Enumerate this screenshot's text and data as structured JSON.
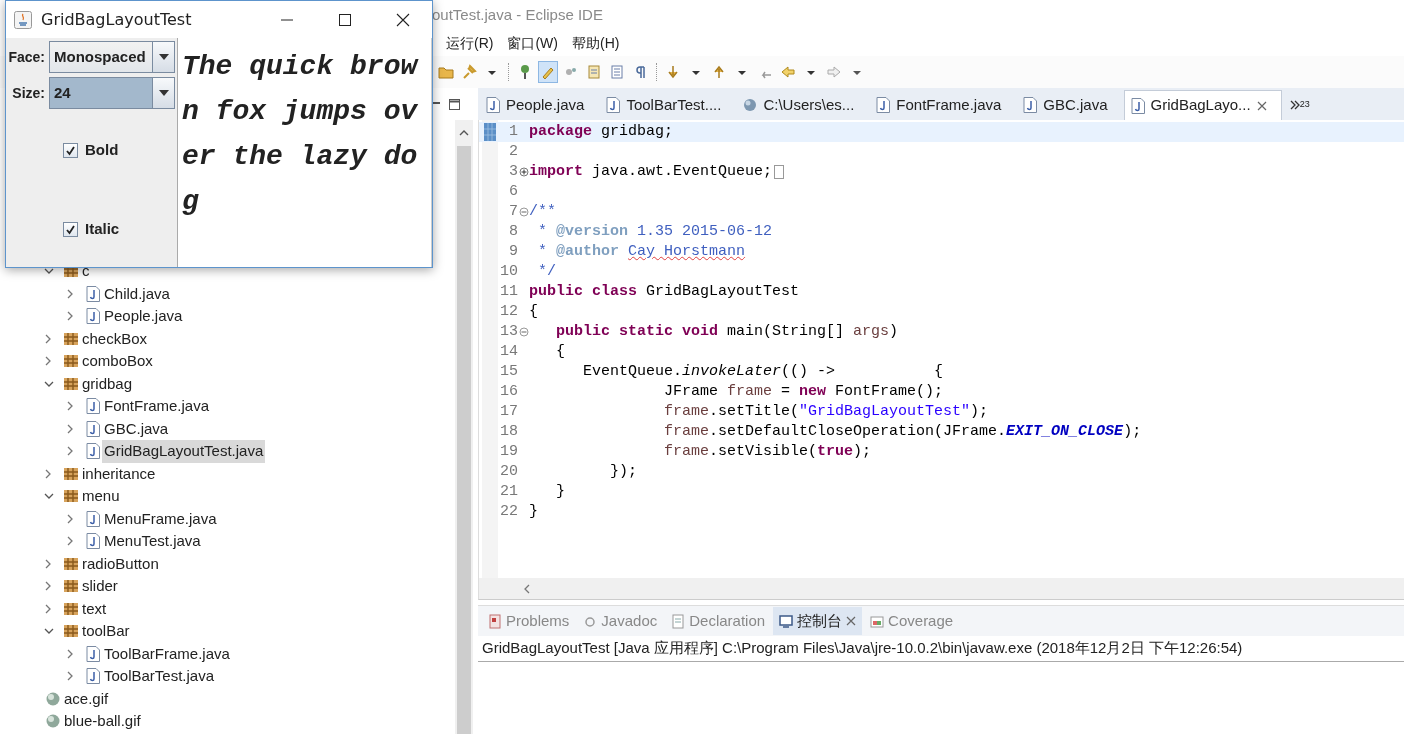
{
  "ide_window": {
    "title": "outTest.java - Eclipse IDE"
  },
  "menu": [
    "运行(R)",
    "窗口(W)",
    "帮助(H)"
  ],
  "toolbar": {
    "highlight_toggle_on": true
  },
  "package_explorer": {
    "packages": [
      {
        "label": "c",
        "expanded": true,
        "selected": false,
        "children": [
          {
            "label": "Child.java",
            "expanded": false,
            "selected": false
          },
          {
            "label": "People.java",
            "expanded": false,
            "selected": false
          }
        ]
      },
      {
        "label": "checkBox",
        "expanded": false,
        "selected": false
      },
      {
        "label": "comboBox",
        "expanded": false,
        "selected": false
      },
      {
        "label": "gridbag",
        "expanded": true,
        "selected": false,
        "children": [
          {
            "label": "FontFrame.java",
            "expanded": false,
            "selected": false
          },
          {
            "label": "GBC.java",
            "expanded": false,
            "selected": false
          },
          {
            "label": "GridBagLayoutTest.java",
            "expanded": false,
            "selected": true
          }
        ]
      },
      {
        "label": "inheritance",
        "expanded": false,
        "selected": false
      },
      {
        "label": "menu",
        "expanded": true,
        "selected": false,
        "children": [
          {
            "label": "MenuFrame.java",
            "expanded": false,
            "selected": false
          },
          {
            "label": "MenuTest.java",
            "expanded": false,
            "selected": false
          }
        ]
      },
      {
        "label": "radioButton",
        "expanded": false,
        "selected": false
      },
      {
        "label": "slider",
        "expanded": false,
        "selected": false
      },
      {
        "label": "text",
        "expanded": false,
        "selected": false
      },
      {
        "label": "toolBar",
        "expanded": true,
        "selected": false,
        "children": [
          {
            "label": "ToolBarFrame.java",
            "expanded": false,
            "selected": false
          },
          {
            "label": "ToolBarTest.java",
            "expanded": false,
            "selected": false
          }
        ]
      }
    ],
    "resources": [
      {
        "label": "ace.gif",
        "selected": false
      },
      {
        "label": "blue-ball.gif",
        "selected": false
      }
    ]
  },
  "editor_tabs": [
    {
      "label": "People.java",
      "kind": "java",
      "selected": false
    },
    {
      "label": "ToolBarTest....",
      "kind": "java",
      "selected": false
    },
    {
      "label": "C:\\Users\\es...",
      "kind": "web",
      "selected": false
    },
    {
      "label": "FontFrame.java",
      "kind": "java",
      "selected": false
    },
    {
      "label": "GBC.java",
      "kind": "java",
      "selected": false
    },
    {
      "label": "GridBagLayo...",
      "kind": "java",
      "selected": true
    }
  ],
  "tab_overflow_count": "23",
  "code_lines": [
    {
      "number": "1",
      "current": true,
      "tokens": [
        {
          "kind": "kw",
          "text": "package"
        },
        {
          "kind": "text",
          "text": " gridbag;"
        }
      ]
    },
    {
      "number": "2",
      "current": false
    },
    {
      "number": "3",
      "current": false,
      "folded": true,
      "tokens": [
        {
          "kind": "kw",
          "text": "import"
        },
        {
          "kind": "text",
          "text": " java.awt.EventQueue;"
        }
      ]
    },
    {
      "number": "6",
      "current": false
    },
    {
      "number": "7",
      "current": false,
      "folded": false,
      "tokens": [
        {
          "kind": "comment",
          "text": "/**"
        }
      ]
    },
    {
      "number": "8",
      "current": false,
      "tokens": [
        {
          "kind": "comment",
          "text": " * "
        },
        {
          "kind": "doctag",
          "text": "@version"
        },
        {
          "kind": "comment",
          "text": " 1.35 2015-06-12"
        }
      ]
    },
    {
      "number": "9",
      "current": false,
      "tokens": [
        {
          "kind": "comment",
          "text": " * "
        },
        {
          "kind": "doctag",
          "text": "@author "
        },
        {
          "kind": "misspelled",
          "text": "Cay Horstmann"
        }
      ]
    },
    {
      "number": "10",
      "current": false,
      "tokens": [
        {
          "kind": "comment",
          "text": " */"
        }
      ]
    },
    {
      "number": "11",
      "current": false,
      "tokens": [
        {
          "kind": "kw",
          "text": "public class"
        },
        {
          "kind": "text",
          "text": " GridBagLayoutTest"
        }
      ]
    },
    {
      "number": "12",
      "current": false,
      "tokens": [
        {
          "kind": "text",
          "text": "{"
        }
      ]
    },
    {
      "number": "13",
      "current": false,
      "folded": false,
      "tokens": [
        {
          "kind": "kw",
          "text": "   public static void"
        },
        {
          "kind": "text",
          "text": " main(String[] "
        },
        {
          "kind": "local",
          "text": "args"
        },
        {
          "kind": "text",
          "text": ")"
        }
      ]
    },
    {
      "number": "14",
      "current": false,
      "tokens": [
        {
          "kind": "text",
          "text": "   {"
        }
      ]
    },
    {
      "number": "15",
      "current": false,
      "tokens": [
        {
          "kind": "text",
          "text": "      EventQueue."
        },
        {
          "kind": "italic",
          "text": "invokeLater"
        },
        {
          "kind": "text",
          "text": "(() ->           {"
        }
      ]
    },
    {
      "number": "16",
      "current": false,
      "tokens": [
        {
          "kind": "text",
          "text": "               JFrame "
        },
        {
          "kind": "local",
          "text": "frame"
        },
        {
          "kind": "text",
          "text": " = "
        },
        {
          "kind": "kw",
          "text": "new"
        },
        {
          "kind": "text",
          "text": " FontFrame();"
        }
      ]
    },
    {
      "number": "17",
      "current": false,
      "tokens": [
        {
          "kind": "local",
          "text": "               frame"
        },
        {
          "kind": "text",
          "text": ".setTitle("
        },
        {
          "kind": "string",
          "text": "\"GridBagLayoutTest\""
        },
        {
          "kind": "text",
          "text": ");"
        }
      ]
    },
    {
      "number": "18",
      "current": false,
      "tokens": [
        {
          "kind": "local",
          "text": "               frame"
        },
        {
          "kind": "text",
          "text": ".setDefaultCloseOperation(JFrame."
        },
        {
          "kind": "const",
          "text": "EXIT_ON_CLOSE"
        },
        {
          "kind": "text",
          "text": ");"
        }
      ]
    },
    {
      "number": "19",
      "current": false,
      "tokens": [
        {
          "kind": "local",
          "text": "               frame"
        },
        {
          "kind": "text",
          "text": ".setVisible("
        },
        {
          "kind": "kw",
          "text": "true"
        },
        {
          "kind": "text",
          "text": ");"
        }
      ]
    },
    {
      "number": "20",
      "current": false,
      "tokens": [
        {
          "kind": "text",
          "text": "         });"
        }
      ]
    },
    {
      "number": "21",
      "current": false,
      "tokens": [
        {
          "kind": "text",
          "text": "   }"
        }
      ]
    },
    {
      "number": "22",
      "current": false,
      "tokens": [
        {
          "kind": "text",
          "text": "}"
        }
      ]
    }
  ],
  "bottom_tabs": [
    {
      "label": "Problems",
      "kind": "problems",
      "selected": false
    },
    {
      "label": "Javadoc",
      "kind": "javadoc",
      "selected": false
    },
    {
      "label": "Declaration",
      "kind": "declaration",
      "selected": false
    },
    {
      "label": "控制台",
      "kind": "console",
      "selected": true
    },
    {
      "label": "Coverage",
      "kind": "coverage",
      "selected": false
    }
  ],
  "console": {
    "text": "GridBagLayoutTest [Java 应用程序] C:\\Program Files\\Java\\jre-10.0.2\\bin\\javaw.exe  (2018年12月2日 下午12:26:54)"
  },
  "app_window": {
    "title": "GridBagLayoutTest",
    "fields": [
      {
        "label": "Face:",
        "value": "Monospaced",
        "focused": false
      },
      {
        "label": "Size:",
        "value": "24",
        "focused": true
      }
    ],
    "checkboxes": [
      {
        "label": "Bold",
        "checked": true
      },
      {
        "label": "Italic",
        "checked": true
      }
    ],
    "sample_text": "The quick brown fox jumps over the lazy dog"
  }
}
